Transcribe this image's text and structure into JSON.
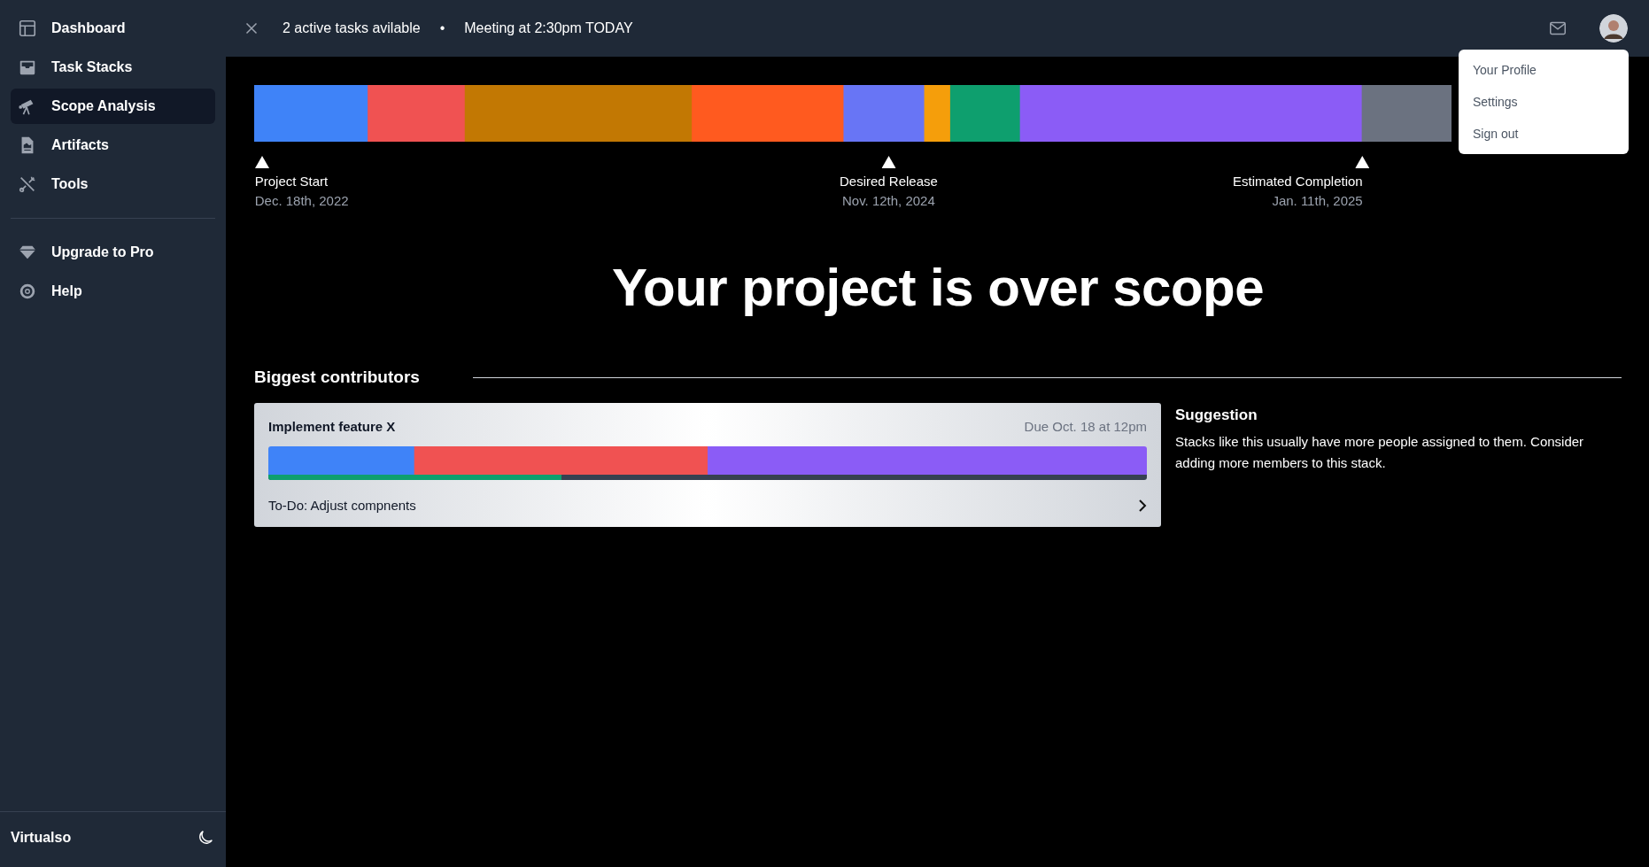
{
  "sidebar": {
    "items": [
      {
        "label": "Dashboard",
        "selected": false
      },
      {
        "label": "Task Stacks",
        "selected": false
      },
      {
        "label": "Scope Analysis",
        "selected": true
      },
      {
        "label": "Artifacts",
        "selected": false
      },
      {
        "label": "Tools",
        "selected": false
      }
    ],
    "secondary_items": [
      {
        "label": "Upgrade to Pro",
        "selected": false
      },
      {
        "label": "Help",
        "selected": false
      }
    ],
    "footer": {
      "brand": "Virtualso"
    }
  },
  "topbar": {
    "notices": [
      "2 active tasks avilable",
      "•",
      "Meeting at 2:30pm TODAY"
    ]
  },
  "user_menu": {
    "items": [
      "Your Profile",
      "Settings",
      "Sign out"
    ]
  },
  "timeline": {
    "milestones": [
      {
        "label": "Project Start",
        "date": "Dec. 18th, 2022"
      },
      {
        "label": "Desired Release",
        "date": "Nov. 12th, 2024"
      },
      {
        "label": "Estimated Completion",
        "date": "Jan. 11th, 2025"
      }
    ]
  },
  "headline": "Your project is over scope",
  "contributors": {
    "title": "Biggest contributors",
    "items": [
      {
        "title": "Implement feature X",
        "due": "Due Oct. 18 at 12pm",
        "progress": {
          "level": 0.334
        },
        "todo": "To-Do: Adjust compnents"
      }
    ],
    "suggestion": {
      "title": "Suggestion",
      "text": "Stacks like this usually have more people assigned to them. Consider adding more members to this stack."
    }
  }
}
